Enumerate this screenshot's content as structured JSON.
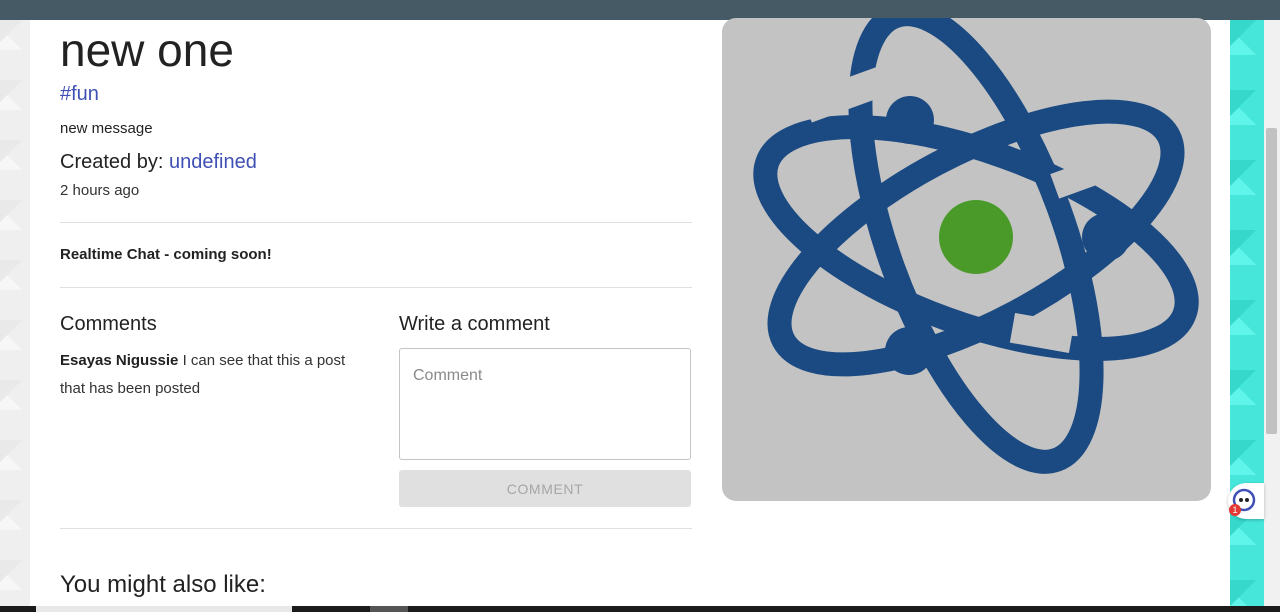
{
  "post": {
    "title": "new one",
    "tag": "#fun",
    "message": "new message",
    "created_label": "Created by:",
    "author": "undefined",
    "time": "2 hours ago"
  },
  "realtime_notice": "Realtime Chat - coming soon!",
  "comments": {
    "heading": "Comments",
    "items": [
      {
        "author": "Esayas Nigussie",
        "text": "I can see that this a post that has been posted"
      }
    ]
  },
  "write_comment": {
    "heading": "Write a comment",
    "placeholder": "Comment",
    "value": "",
    "button_label": "COMMENT"
  },
  "recommendations": {
    "heading": "You might also like:"
  },
  "image": {
    "icon": "atom-icon",
    "background": "#c3c3c3",
    "orbit_color": "#1b4a82",
    "nucleus_color": "#4a9a2a"
  },
  "widget": {
    "icon": "chat-assistant-icon",
    "badge_count": "1"
  },
  "colors": {
    "topbar": "#455a64",
    "link": "#3f51b5"
  }
}
